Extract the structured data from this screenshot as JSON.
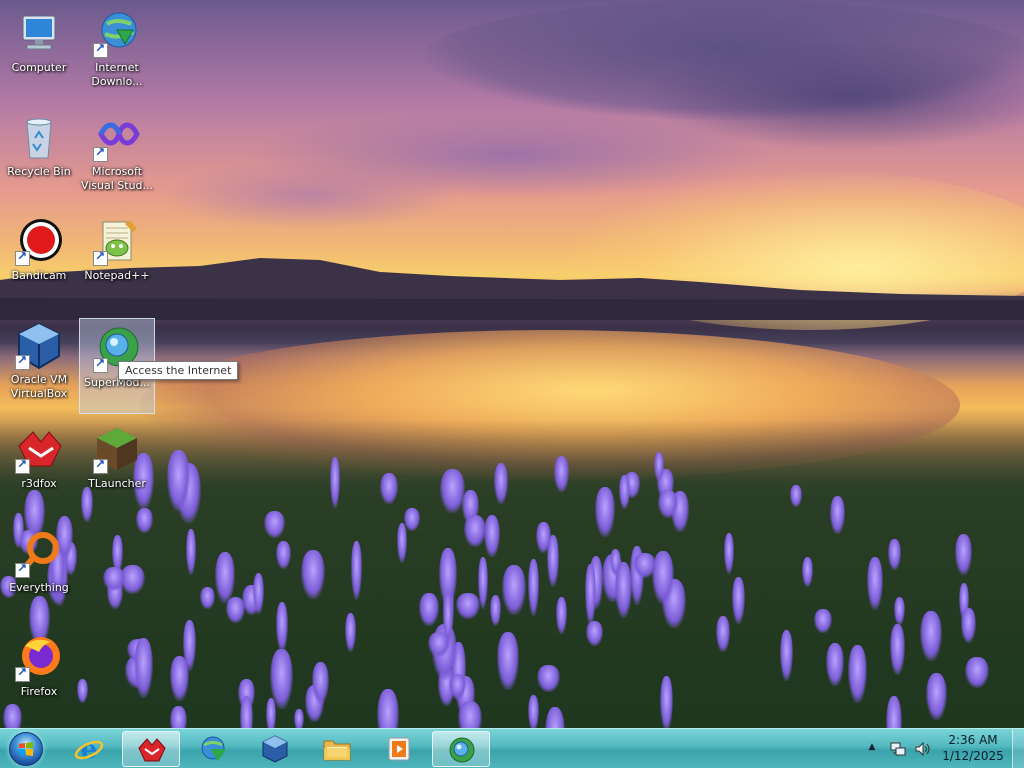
{
  "desktop": {
    "icons": [
      {
        "label": "Computer",
        "icon": "computer-icon"
      },
      {
        "label": "Internet Downlo...",
        "icon": "internet-download-manager-icon"
      },
      {
        "label": "Recycle Bin",
        "icon": "recycle-bin-icon"
      },
      {
        "label": "Microsoft Visual Stud...",
        "icon": "visual-studio-icon"
      },
      {
        "label": "Bandicam",
        "icon": "bandicam-icon"
      },
      {
        "label": "Notepad++",
        "icon": "notepad-plus-plus-icon"
      },
      {
        "label": "Oracle VM VirtualBox",
        "icon": "virtualbox-icon"
      },
      {
        "label": "SuperMod...",
        "icon": "supermodem-icon"
      },
      {
        "label": "r3dfox",
        "icon": "r3dfox-icon"
      },
      {
        "label": "TLauncher",
        "icon": "tlauncher-icon"
      },
      {
        "label": "Everything",
        "icon": "everything-search-icon"
      },
      {
        "label": "Firefox",
        "icon": "firefox-icon"
      }
    ],
    "tooltip": "Access the Internet"
  },
  "taskbar": {
    "start_icon": "windows-start-orb-icon",
    "pinned": [
      {
        "name": "Internet Explorer",
        "icon": "internet-explorer-icon"
      },
      {
        "name": "r3dfox",
        "icon": "r3dfox-icon"
      },
      {
        "name": "Internet Download Manager",
        "icon": "internet-download-manager-icon"
      },
      {
        "name": "Oracle VM VirtualBox",
        "icon": "virtualbox-icon"
      },
      {
        "name": "Windows Explorer",
        "icon": "folder-icon"
      },
      {
        "name": "Media Player",
        "icon": "media-player-icon"
      },
      {
        "name": "SuperModem",
        "icon": "supermodem-icon"
      }
    ],
    "tray": {
      "time": "2:36 AM",
      "date": "1/12/2025"
    }
  },
  "colors": {
    "taskbar": "#4fb6bc",
    "selection": "#becde6"
  }
}
